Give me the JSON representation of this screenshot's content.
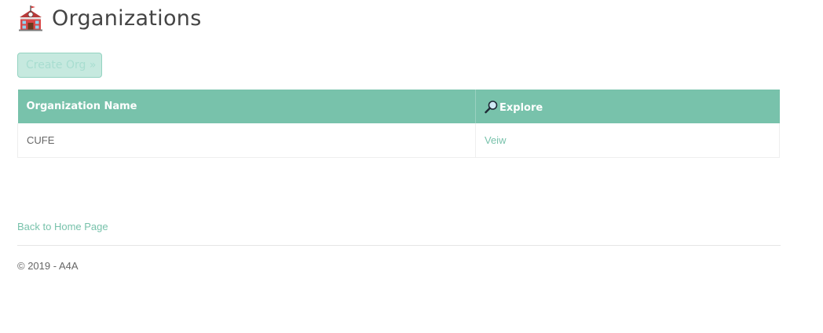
{
  "page": {
    "title": "Organizations",
    "header_icon": "school-icon"
  },
  "actions": {
    "create_label": "Create Org »"
  },
  "table": {
    "columns": [
      {
        "label": "Organization Name"
      },
      {
        "label": "Explore",
        "icon": "magnifying-glass-icon"
      }
    ],
    "rows": [
      {
        "name": "CUFE",
        "action": "Veiw"
      }
    ]
  },
  "nav": {
    "back_label": "Back to Home Page"
  },
  "footer": {
    "text": "© 2019 - A4A"
  },
  "colors": {
    "accent": "#78c2ab",
    "button_bg": "#c6e9df",
    "button_text": "#a8ddd0",
    "text": "#555555"
  }
}
